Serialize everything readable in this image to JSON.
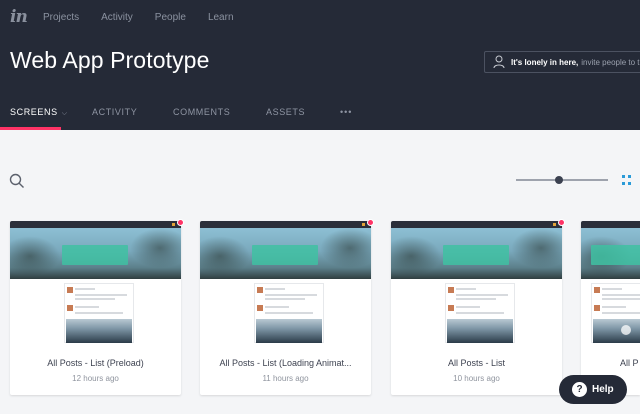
{
  "logo": "in",
  "topnav": [
    "Projects",
    "Activity",
    "People",
    "Learn"
  ],
  "project_title": "Web App Prototype",
  "invite": {
    "strong": "It's lonely in here,",
    "weak": "invite people to the pr"
  },
  "tabs": {
    "screens": "Screens",
    "activity": "Activity",
    "comments": "Comments",
    "assets": "Assets",
    "more": "•••"
  },
  "accent_color": "#ff3366",
  "zoom_slider_level": 0.47,
  "cards": [
    {
      "name": "All Posts - List (Preload)",
      "time": "12 hours ago",
      "unread": true
    },
    {
      "name": "All Posts - List (Loading Animat...",
      "time": "11 hours ago",
      "unread": true
    },
    {
      "name": "All Posts - List",
      "time": "10 hours ago",
      "unread": true
    },
    {
      "name": "All P",
      "time": "",
      "unread": false
    }
  ],
  "help": {
    "label": "Help",
    "icon": "question-mark-icon"
  }
}
